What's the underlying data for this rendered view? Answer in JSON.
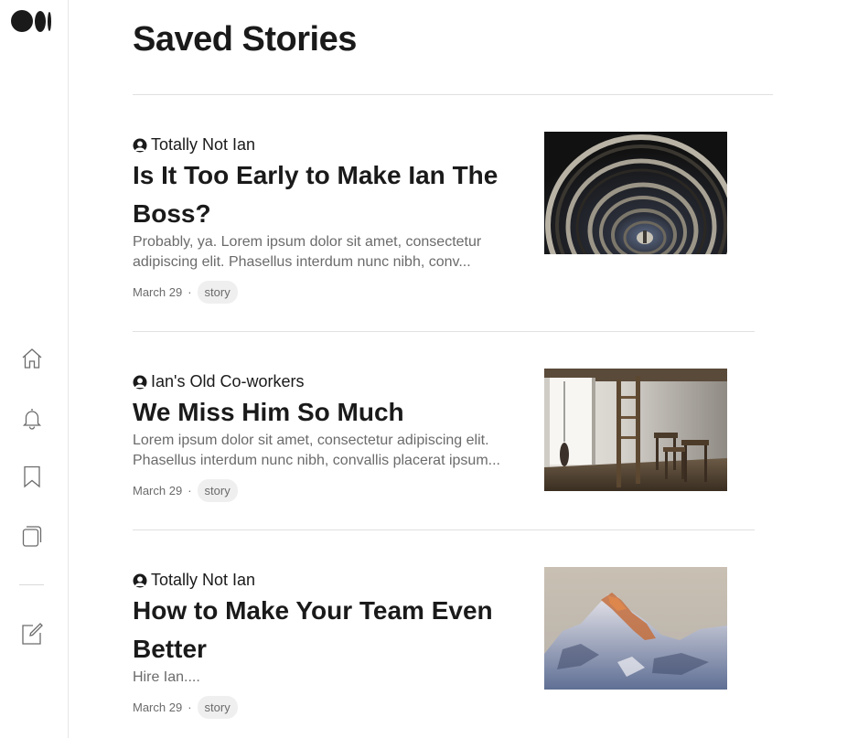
{
  "page": {
    "title": "Saved Stories"
  },
  "sidebar": {
    "logo": "medium-logo",
    "items": [
      {
        "icon": "home-icon"
      },
      {
        "icon": "bell-icon"
      },
      {
        "icon": "bookmark-icon"
      },
      {
        "icon": "stories-icon"
      },
      {
        "icon": "write-icon"
      }
    ]
  },
  "stories": [
    {
      "author": "Totally Not Ian",
      "title": "Is It Too Early to Make Ian The Boss?",
      "snippet": "Probably, ya. Lorem ipsum dolor sit amet, consectetur adipiscing elit. Phasellus interdum nunc nibh, conv...",
      "date": "March 29",
      "separator": "·",
      "tag": "story",
      "image": "spiral-staircase-photo"
    },
    {
      "author": "Ian's Old Co-workers",
      "title": "We Miss Him So Much",
      "snippet": "Lorem ipsum dolor sit amet, consectetur adipiscing elit. Phasellus interdum nunc nibh, convallis placerat ipsum...",
      "date": "March 29",
      "separator": "·",
      "tag": "story",
      "image": "empty-room-photo"
    },
    {
      "author": "Totally Not Ian",
      "title": "How to Make Your Team Even Better",
      "snippet": "Hire Ian....",
      "date": "March 29",
      "separator": "·",
      "tag": "story",
      "image": "snowy-mountain-photo"
    }
  ]
}
